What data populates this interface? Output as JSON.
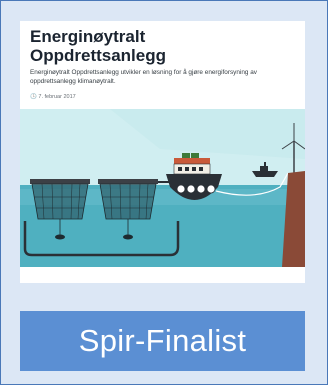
{
  "article": {
    "heading_line1": "Energinøytralt",
    "heading_line2": "Oppdrettsanlegg",
    "description": "Energinøytralt Oppdrettsanlegg utvikler en løsning for å gjøre energiforsyning av oppdrettsanlegg klimanøytralt.",
    "date": "7. februar 2017"
  },
  "badge": {
    "label": "Spir-Finalist"
  },
  "colors": {
    "badge_bg": "#5b8fd3",
    "frame_bg": "#dce7f5",
    "sea": "#4fb0c0",
    "sky": "#c9ebee"
  }
}
